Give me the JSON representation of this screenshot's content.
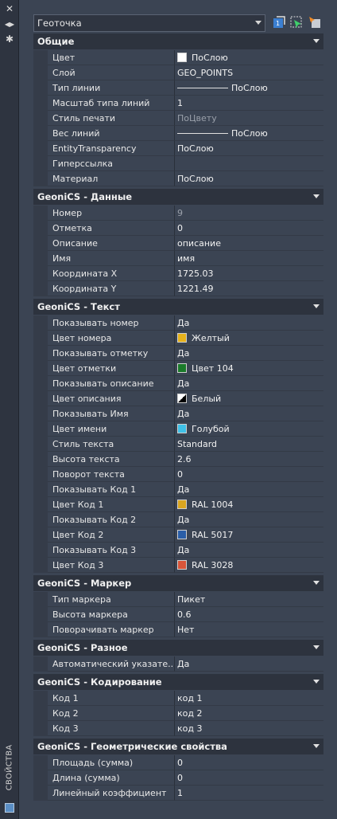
{
  "strip": {
    "close_glyph": "✕",
    "pin_glyph": "◀▶",
    "settings_glyph": "✱",
    "vertical_label": "СВОЙСТВА"
  },
  "selector": {
    "value": "Геоточка"
  },
  "sections": [
    {
      "title": "Общие",
      "rows": [
        {
          "name": "Цвет",
          "value": "ПоСлою",
          "swatch": "#ffffff"
        },
        {
          "name": "Слой",
          "value": "GEO_POINTS"
        },
        {
          "name": "Тип линии",
          "value": "ПоСлою",
          "line": true
        },
        {
          "name": "Масштаб типа линий",
          "value": "1"
        },
        {
          "name": "Стиль печати",
          "value": "ПоЦвету",
          "dim": true
        },
        {
          "name": "Вес линий",
          "value": "ПоСлою",
          "line": true
        },
        {
          "name": "EntityTransparency",
          "value": "ПоСлою"
        },
        {
          "name": "Гиперссылка",
          "value": ""
        },
        {
          "name": "Материал",
          "value": "ПоСлою"
        }
      ]
    },
    {
      "title": "GeoniCS - Данные",
      "rows": [
        {
          "name": "Номер",
          "value": "9",
          "dim": true
        },
        {
          "name": "Отметка",
          "value": "0"
        },
        {
          "name": "Описание",
          "value": "описание"
        },
        {
          "name": "Имя",
          "value": "имя"
        },
        {
          "name": "Координата X",
          "value": "1725.03"
        },
        {
          "name": "Координата Y",
          "value": "1221.49"
        }
      ]
    },
    {
      "title": "GeoniCS - Текст",
      "rows": [
        {
          "name": "Показывать номер",
          "value": "Да"
        },
        {
          "name": "Цвет номера",
          "value": "Желтый",
          "swatch": "#e6b21c"
        },
        {
          "name": "Показывать отметку",
          "value": "Да"
        },
        {
          "name": "Цвет отметки",
          "value": "Цвет 104",
          "swatch": "#1a7a2a"
        },
        {
          "name": "Показывать описание",
          "value": "Да"
        },
        {
          "name": "Цвет описания",
          "value": "Белый",
          "swatch": "split"
        },
        {
          "name": "Показывать Имя",
          "value": "Да"
        },
        {
          "name": "Цвет имени",
          "value": "Голубой",
          "swatch": "#3fc1e8"
        },
        {
          "name": "Стиль текста",
          "value": "Standard"
        },
        {
          "name": "Высота текста",
          "value": "2.6"
        },
        {
          "name": "Поворот текста",
          "value": "0"
        },
        {
          "name": "Показывать Код 1",
          "value": "Да"
        },
        {
          "name": "Цвет Код 1",
          "value": "RAL 1004",
          "swatch": "#d9a520"
        },
        {
          "name": "Показывать Код 2",
          "value": "Да"
        },
        {
          "name": "Цвет Код 2",
          "value": "RAL 5017",
          "swatch": "#2a5ea8"
        },
        {
          "name": "Показывать Код 3",
          "value": "Да"
        },
        {
          "name": "Цвет Код 3",
          "value": "RAL 3028",
          "swatch": "#d8553a"
        }
      ]
    },
    {
      "title": "GeoniCS - Маркер",
      "rows": [
        {
          "name": "Тип маркера",
          "value": "Пикет"
        },
        {
          "name": "Высота маркера",
          "value": "0.6"
        },
        {
          "name": "Поворачивать маркер",
          "value": "Нет"
        }
      ]
    },
    {
      "title": "GeoniCS - Разное",
      "rows": [
        {
          "name": "Автоматический указате...",
          "value": "Да"
        }
      ]
    },
    {
      "title": "GeoniCS - Кодирование",
      "rows": [
        {
          "name": "Код 1",
          "value": "код 1"
        },
        {
          "name": "Код 2",
          "value": "код 2"
        },
        {
          "name": "Код 3",
          "value": "код 3"
        }
      ]
    },
    {
      "title": "GeoniCS - Геометрические свойства",
      "rows": [
        {
          "name": "Площадь (сумма)",
          "value": "0"
        },
        {
          "name": "Длина (сумма)",
          "value": "0"
        },
        {
          "name": "Линейный коэффициент",
          "value": "1"
        }
      ]
    }
  ]
}
